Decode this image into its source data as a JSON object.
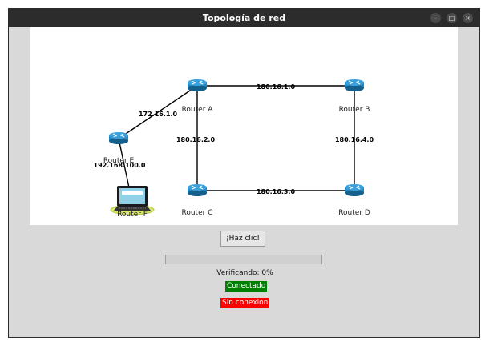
{
  "window": {
    "title": "Topología de red",
    "controls": [
      "–",
      "□",
      "×"
    ]
  },
  "network": {
    "links": [
      {
        "from": "A",
        "to": "B",
        "label": "180.16.1.0"
      },
      {
        "from": "A",
        "to": "C",
        "label": "180.16.2.0"
      },
      {
        "from": "C",
        "to": "D",
        "label": "180.16.3.0"
      },
      {
        "from": "B",
        "to": "D",
        "label": "180.16.4.0"
      },
      {
        "from": "E",
        "to": "A",
        "label": "172.16.1.0"
      },
      {
        "from": "E",
        "to": "F",
        "label": "192.168.100.0"
      }
    ],
    "nodes": [
      {
        "id": "A",
        "label": "Router A",
        "icon": "router-icon"
      },
      {
        "id": "B",
        "label": "Router B",
        "icon": "router-icon"
      },
      {
        "id": "C",
        "label": "Router C",
        "icon": "router-icon"
      },
      {
        "id": "D",
        "label": "Router D",
        "icon": "router-icon"
      },
      {
        "id": "E",
        "label": "Router E",
        "icon": "router-icon"
      },
      {
        "id": "F",
        "label": "Router F",
        "icon": "laptop-icon"
      }
    ]
  },
  "controls": {
    "button_label": "¡Haz clic!",
    "progress_percent": 0,
    "status_text": "Verificando: 0%",
    "connected_label": "Conectado",
    "disconnected_label": "Sin conexion"
  },
  "colors": {
    "connected": "#008000",
    "disconnected": "#ff0000",
    "router": "#1e8ac8",
    "titlebar": "#2c2c2c"
  }
}
